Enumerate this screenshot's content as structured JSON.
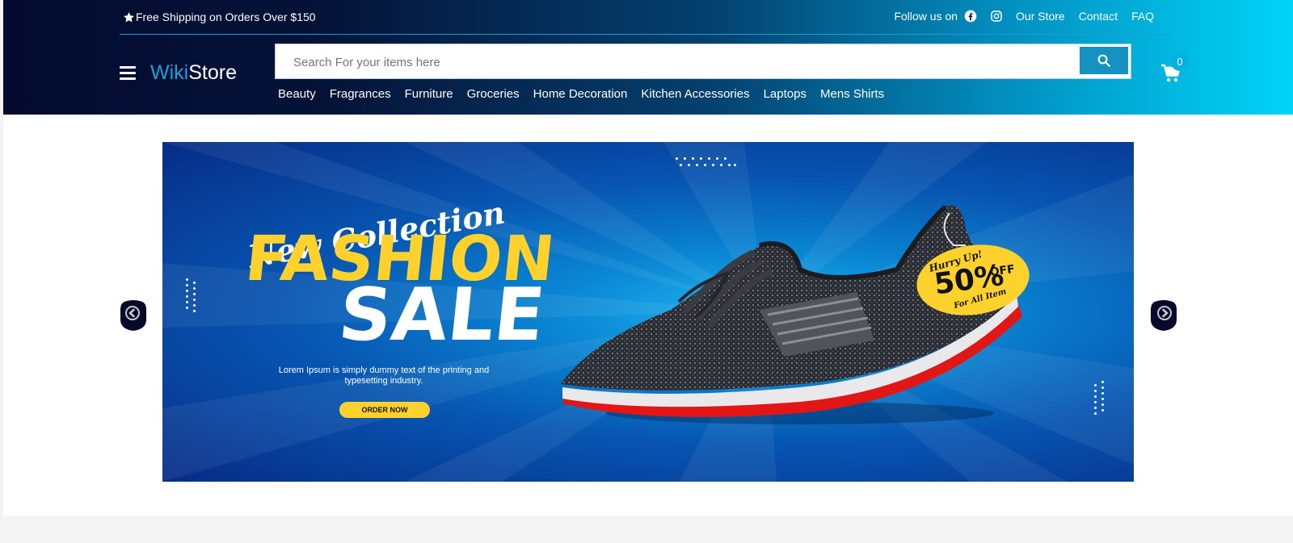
{
  "topbar": {
    "promo_text": "Free Shipping on Orders Over $150",
    "follow_label": "Follow us on",
    "links": [
      "Our Store",
      "Contact",
      "FAQ"
    ]
  },
  "logo": {
    "part1": "Wiki",
    "part2": "Store"
  },
  "search": {
    "placeholder": "Search For your items here",
    "value": ""
  },
  "cart": {
    "count": "0"
  },
  "categories": [
    "Beauty",
    "Fragrances",
    "Furniture",
    "Groceries",
    "Home Decoration",
    "Kitchen Accessories",
    "Laptops",
    "Mens Shirts"
  ],
  "banner": {
    "script_heading": "New Collection",
    "heading_line1": "FASHION",
    "heading_line2": "SALE",
    "description": "Lorem Ipsum is simply dummy text of the printing and typesetting industry.",
    "cta": "ORDER NOW",
    "tag_hurry": "Hurry Up!",
    "tag_percent": "50%",
    "tag_off": "OFF",
    "tag_for_all": "For All Item"
  },
  "colors": {
    "header_gradient_start": "#030a30",
    "header_gradient_end": "#00d4f7",
    "accent": "#1591c2",
    "sale_yellow": "#ffd12c"
  }
}
